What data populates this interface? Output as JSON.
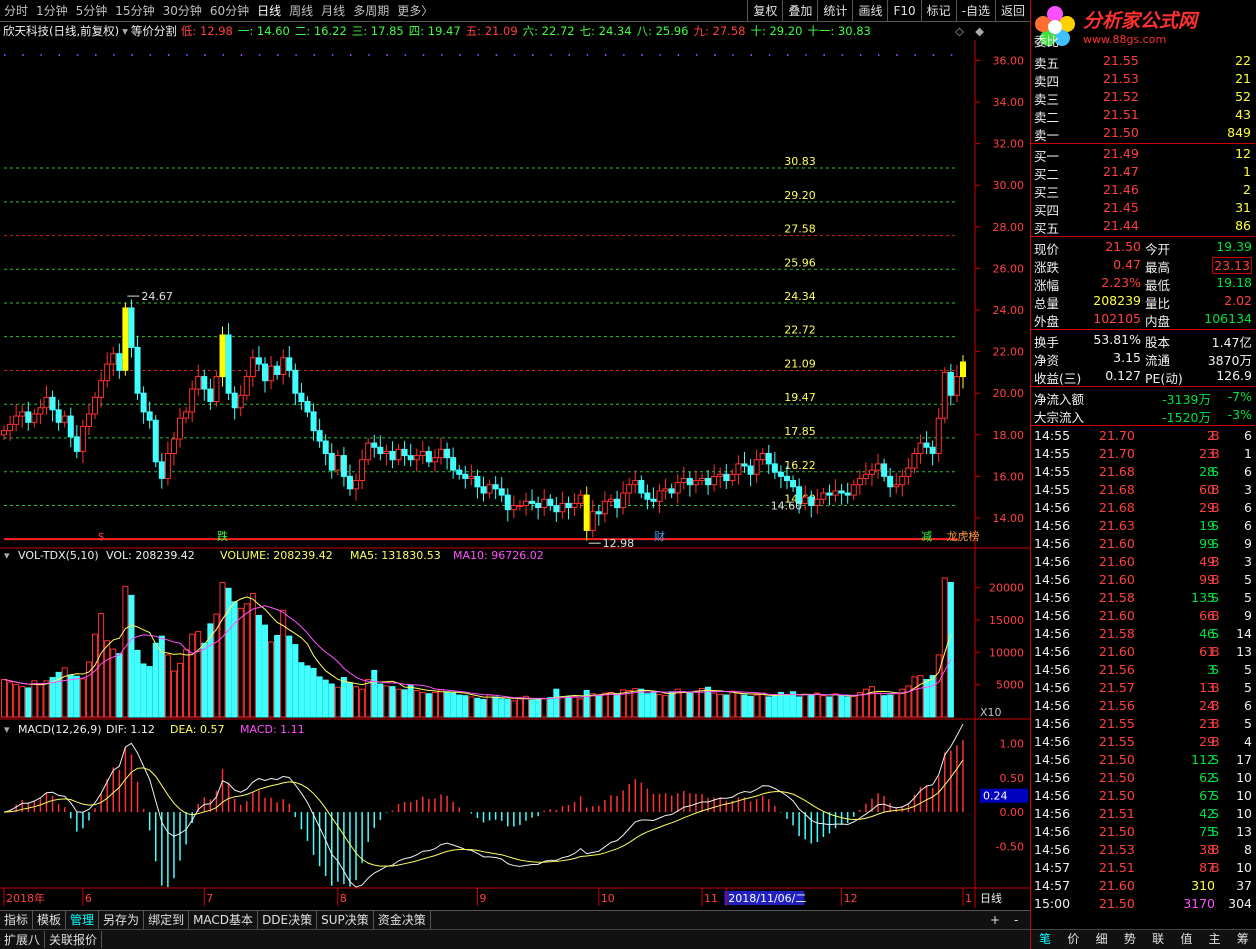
{
  "toolbar": {
    "periods": [
      "分时",
      "1分钟",
      "5分钟",
      "15分钟",
      "30分钟",
      "60分钟",
      "日线",
      "周线",
      "月线",
      "多周期",
      "更多〉"
    ],
    "active": "日线",
    "tools": [
      "复权",
      "叠加",
      "统计",
      "画线",
      "F10",
      "标记",
      "-自选",
      "返回"
    ]
  },
  "info": {
    "name": "欣天科技(日线,前复权)",
    "indicator": "等价分割",
    "items": [
      {
        "t": "低: 12.98",
        "c": "#ff4040"
      },
      {
        "t": "一: 14.60",
        "c": "#40ff40"
      },
      {
        "t": "二: 16.22",
        "c": "#40ff40"
      },
      {
        "t": "三: 17.85",
        "c": "#40ff40"
      },
      {
        "t": "四: 19.47",
        "c": "#40ff40"
      },
      {
        "t": "五: 21.09",
        "c": "#ff4040"
      },
      {
        "t": "六: 22.72",
        "c": "#40ff40"
      },
      {
        "t": "七: 24.34",
        "c": "#40ff40"
      },
      {
        "t": "八: 25.96",
        "c": "#40ff40"
      },
      {
        "t": "九: 27.58",
        "c": "#ff4040"
      },
      {
        "t": "十: 29.20",
        "c": "#40ff40"
      },
      {
        "t": "十一: 30.83",
        "c": "#40ff40"
      }
    ]
  },
  "chart_data": [
    {
      "type": "candlestick",
      "price_axis": [
        14.0,
        16.0,
        18.0,
        20.0,
        22.0,
        24.0,
        26.0,
        28.0,
        30.0,
        32.0,
        34.0,
        36.0
      ],
      "ylim": [
        12.7,
        36.6
      ],
      "levels": [
        {
          "v": 30.83,
          "c": "g"
        },
        {
          "v": 29.2,
          "c": "g"
        },
        {
          "v": 27.58,
          "c": "r"
        },
        {
          "v": 25.96,
          "c": "g"
        },
        {
          "v": 24.34,
          "c": "g"
        },
        {
          "v": 22.72,
          "c": "g"
        },
        {
          "v": 21.09,
          "c": "r"
        },
        {
          "v": 19.47,
          "c": "g"
        },
        {
          "v": 17.85,
          "c": "g"
        },
        {
          "v": 16.22,
          "c": "g"
        },
        {
          "v": 14.6,
          "c": "g"
        }
      ],
      "low_line": 12.98,
      "annotations": {
        "high": "24.67",
        "low": "12.98",
        "last_low": "14.60"
      },
      "markers": [
        {
          "t": "$",
          "i": 16,
          "c": "#ff4040"
        },
        {
          "t": "跌",
          "i": 36,
          "c": "#40ff40"
        },
        {
          "t": "财",
          "i": 108,
          "c": "#40a0ff"
        },
        {
          "t": "减",
          "i": 152,
          "c": "#40ff40"
        },
        {
          "t": "龙虎榜",
          "i": 158,
          "c": "#ffa040"
        }
      ],
      "closes": [
        18.2,
        18.5,
        18.9,
        19.1,
        18.6,
        19.0,
        19.3,
        19.8,
        19.2,
        18.6,
        18.9,
        17.9,
        17.2,
        18.4,
        19.0,
        19.8,
        20.6,
        21.4,
        21.9,
        21.1,
        24.1,
        22.2,
        20.0,
        19.1,
        18.7,
        16.7,
        15.9,
        17.1,
        17.8,
        18.8,
        19.1,
        20.2,
        20.8,
        20.2,
        19.6,
        20.8,
        22.8,
        20.0,
        19.3,
        19.9,
        20.8,
        21.7,
        21.4,
        20.6,
        21.3,
        20.9,
        21.7,
        21.1,
        20.0,
        19.6,
        19.1,
        18.2,
        17.7,
        17.1,
        16.3,
        17.0,
        16.0,
        15.4,
        15.8,
        16.8,
        17.6,
        17.4,
        17.1,
        17.2,
        16.8,
        17.3,
        17.0,
        16.8,
        17.0,
        17.2,
        16.7,
        16.9,
        17.3,
        16.9,
        16.3,
        16.1,
        15.9,
        16.0,
        15.5,
        15.2,
        15.6,
        15.4,
        15.1,
        14.4,
        14.6,
        14.6,
        14.8,
        14.7,
        14.5,
        14.9,
        14.6,
        14.3,
        14.7,
        14.5,
        14.7,
        15.1,
        13.4,
        14.3,
        14.2,
        14.8,
        14.9,
        14.5,
        15.2,
        15.6,
        15.8,
        15.2,
        14.9,
        14.8,
        15.3,
        15.4,
        15.2,
        15.7,
        15.9,
        15.6,
        15.8,
        15.9,
        15.6,
        16.0,
        16.1,
        15.8,
        16.1,
        16.6,
        16.5,
        16.1,
        16.8,
        17.1,
        16.6,
        16.2,
        16.0,
        15.8,
        15.5,
        14.7,
        15.0,
        14.6,
        14.9,
        15.2,
        15.1,
        15.3,
        15.2,
        15.1,
        15.6,
        15.9,
        16.1,
        16.3,
        16.6,
        16.0,
        15.5,
        15.6,
        16.0,
        16.4,
        17.1,
        17.6,
        17.4,
        17.1,
        18.8,
        21.0,
        19.9,
        20.8,
        21.5
      ],
      "hi_cut": [
        20,
        36,
        96,
        158,
        159
      ]
    },
    {
      "type": "bar",
      "title": "VOL-TDX(5,10)",
      "vol_axis": [
        5000,
        10000,
        15000,
        20000
      ],
      "ylim": [
        0,
        23500
      ],
      "labels": {
        "vol": "VOL: 208239.42",
        "volume": "VOLUME: 208239.42",
        "ma5": "MA5: 131830.53",
        "ma10": "MA10: 96726.02"
      },
      "unit": "X10",
      "volumes": [
        5800,
        5400,
        5000,
        4700,
        4500,
        5600,
        5100,
        5600,
        6100,
        6900,
        7600,
        6500,
        6300,
        5900,
        8500,
        12800,
        16000,
        11800,
        10500,
        9800,
        20200,
        18800,
        10300,
        8200,
        7800,
        11400,
        12500,
        9600,
        7100,
        8300,
        10400,
        12800,
        13200,
        11400,
        14400,
        15900,
        20800,
        19900,
        17800,
        16800,
        17500,
        19100,
        15700,
        14200,
        11600,
        12600,
        16500,
        12500,
        11200,
        8400,
        7900,
        7500,
        6200,
        5700,
        5100,
        4600,
        6100,
        5300,
        4700,
        4300,
        5800,
        7200,
        5100,
        4800,
        4700,
        4300,
        4200,
        4900,
        4100,
        3800,
        3600,
        3800,
        4200,
        3900,
        3700,
        3400,
        3300,
        3100,
        2900,
        2700,
        3400,
        3100,
        2800,
        2700,
        2500,
        3000,
        3200,
        2600,
        2700,
        2800,
        3000,
        4300,
        3000,
        3100,
        3200,
        2800,
        4100,
        3600,
        3400,
        3700,
        3800,
        3500,
        4200,
        4100,
        4400,
        4300,
        3600,
        3700,
        3500,
        3300,
        3900,
        4300,
        3900,
        3700,
        4000,
        4400,
        4600,
        3700,
        3500,
        3400,
        4000,
        3800,
        3400,
        3200,
        3400,
        3700,
        3100,
        3200,
        3800,
        3300,
        3900,
        3100,
        3500,
        3500,
        3700,
        3300,
        3100,
        3600,
        3300,
        3100,
        3200,
        3800,
        4300,
        4700,
        3700,
        3300,
        3400,
        3600,
        4300,
        4800,
        6200,
        6400,
        5800,
        6400,
        9600,
        21500,
        20800
      ]
    },
    {
      "type": "macd",
      "title": "MACD(12,26,9)",
      "macd_axis": [
        "1.00",
        "0.50",
        "0.00",
        "-0.50"
      ],
      "ylim": [
        -1.08,
        1.2
      ],
      "readout": "0.24",
      "labels": {
        "dif": "DIF: 1.12",
        "dea": "DEA: 0.57",
        "macd": "MACD: 1.11"
      },
      "x_labels": [
        {
          "t": "2018年",
          "i": 0
        },
        {
          "t": "6",
          "i": 13
        },
        {
          "t": "7",
          "i": 33
        },
        {
          "t": "8",
          "i": 55
        },
        {
          "t": "9",
          "i": 78
        },
        {
          "t": "10",
          "i": 98
        },
        {
          "t": "11",
          "i": 115
        },
        {
          "t": "2018/11/06/二",
          "i": 119,
          "hl": true
        },
        {
          "t": "12",
          "i": 138
        },
        {
          "t": "1",
          "i": 158
        }
      ],
      "period_tag": "日线"
    }
  ],
  "bottom_tabs": [
    "指标",
    "模板",
    "管理",
    "另存为",
    "绑定到",
    "MACD基本",
    "DDE决策",
    "SUP决策",
    "资金决策"
  ],
  "bottom_tab_active": "管理",
  "bottom2": [
    "扩展八",
    "关联报价"
  ],
  "rp": {
    "logo": {
      "title": "分析家公式网",
      "url": "www.88gs.com"
    },
    "hdr": "委比",
    "asks": [
      [
        "卖五",
        "21.55",
        "22"
      ],
      [
        "卖四",
        "21.53",
        "21"
      ],
      [
        "卖三",
        "21.52",
        "52"
      ],
      [
        "卖二",
        "21.51",
        "43"
      ],
      [
        "卖一",
        "21.50",
        "849"
      ]
    ],
    "bids": [
      [
        "买一",
        "21.49",
        "12"
      ],
      [
        "买二",
        "21.47",
        "1"
      ],
      [
        "买三",
        "21.46",
        "2"
      ],
      [
        "买四",
        "21.45",
        "31"
      ],
      [
        "买五",
        "21.44",
        "86"
      ]
    ],
    "quote": [
      {
        "l1": "现价",
        "v1": "21.50",
        "c1": "red",
        "l2": "今开",
        "v2": "19.39",
        "c2": "grn"
      },
      {
        "l1": "涨跌",
        "v1": "0.47",
        "c1": "red",
        "l2": "最高",
        "v2": "23.13",
        "c2": "red",
        "box": true
      },
      {
        "l1": "涨幅",
        "v1": "2.23%",
        "c1": "red",
        "l2": "最低",
        "v2": "19.18",
        "c2": "grn"
      },
      {
        "l1": "总量",
        "v1": "208239",
        "c1": "yel",
        "l2": "量比",
        "v2": "2.02",
        "c2": "red"
      },
      {
        "l1": "外盘",
        "v1": "102105",
        "c1": "red",
        "l2": "内盘",
        "v2": "106134",
        "c2": "grn"
      }
    ],
    "fund": [
      {
        "l1": "换手",
        "v1": "53.81%",
        "l2": "股本",
        "v2": "1.47亿"
      },
      {
        "l1": "净资",
        "v1": "3.15",
        "l2": "流通",
        "v2": "3870万"
      },
      {
        "l1": "收益(三)",
        "v1": "0.127",
        "l2": "PE(动)",
        "v2": "126.9"
      }
    ],
    "flow": [
      [
        "净流入额",
        "-3139万",
        "-7%"
      ],
      [
        "大宗流入",
        "-1520万",
        "-3%"
      ]
    ],
    "ticks": [
      [
        "14:55",
        "21.70",
        "2",
        "B",
        "6"
      ],
      [
        "14:55",
        "21.70",
        "23",
        "B",
        "1"
      ],
      [
        "14:55",
        "21.68",
        "28",
        "S",
        "6"
      ],
      [
        "14:55",
        "21.68",
        "60",
        "B",
        "3"
      ],
      [
        "14:56",
        "21.68",
        "29",
        "B",
        "6"
      ],
      [
        "14:56",
        "21.63",
        "19",
        "S",
        "6"
      ],
      [
        "14:56",
        "21.60",
        "99",
        "S",
        "9"
      ],
      [
        "14:56",
        "21.60",
        "49",
        "B",
        "3"
      ],
      [
        "14:56",
        "21.60",
        "99",
        "B",
        "5"
      ],
      [
        "14:56",
        "21.58",
        "135",
        "S",
        "5"
      ],
      [
        "14:56",
        "21.60",
        "66",
        "B",
        "9"
      ],
      [
        "14:56",
        "21.58",
        "46",
        "S",
        "14"
      ],
      [
        "14:56",
        "21.60",
        "61",
        "B",
        "13"
      ],
      [
        "14:56",
        "21.56",
        "3",
        "S",
        "5"
      ],
      [
        "14:56",
        "21.57",
        "13",
        "B",
        "5"
      ],
      [
        "14:56",
        "21.56",
        "24",
        "B",
        "6"
      ],
      [
        "14:56",
        "21.55",
        "23",
        "B",
        "5"
      ],
      [
        "14:56",
        "21.55",
        "29",
        "B",
        "4"
      ],
      [
        "14:56",
        "21.50",
        "112",
        "S",
        "17"
      ],
      [
        "14:56",
        "21.50",
        "62",
        "S",
        "10"
      ],
      [
        "14:56",
        "21.50",
        "67",
        "S",
        "10"
      ],
      [
        "14:56",
        "21.51",
        "42",
        "S",
        "10"
      ],
      [
        "14:56",
        "21.50",
        "75",
        "S",
        "13"
      ],
      [
        "14:56",
        "21.53",
        "38",
        "B",
        "8"
      ],
      [
        "14:57",
        "21.51",
        "87",
        "B",
        "10"
      ],
      [
        "14:57",
        "21.60",
        "310",
        "",
        "37"
      ],
      [
        "15:00",
        "21.50",
        "3170",
        "",
        "304"
      ]
    ],
    "foot": [
      "笔",
      "价",
      "细",
      "势",
      "联",
      "值",
      "主",
      "筹"
    ],
    "foot_active": "笔"
  }
}
